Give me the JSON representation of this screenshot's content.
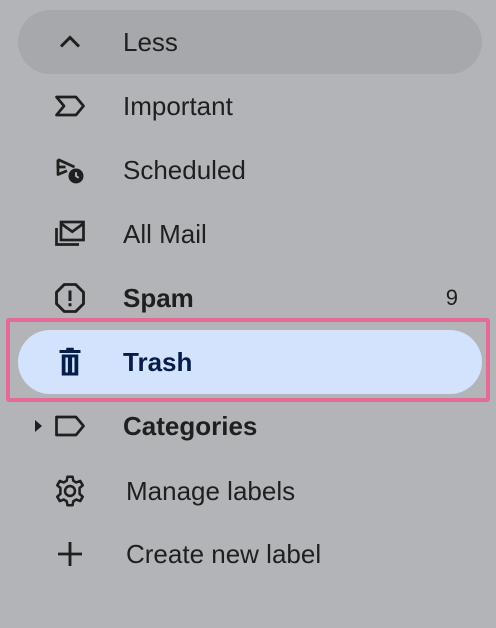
{
  "colors": {
    "background": "#b3b4b8",
    "hover_row": "#a7a8ac",
    "selected_row": "#d3e3fd",
    "selected_text": "#041e49",
    "highlight_border": "#e36b96"
  },
  "nav": {
    "items": [
      {
        "label": "Less",
        "icon": "chevron-up-icon"
      },
      {
        "label": "Important",
        "icon": "important-label-icon"
      },
      {
        "label": "Scheduled",
        "icon": "scheduled-send-icon"
      },
      {
        "label": "All Mail",
        "icon": "all-mail-icon"
      },
      {
        "label": "Spam",
        "icon": "spam-icon",
        "count": "9"
      },
      {
        "label": "Trash",
        "icon": "trash-icon",
        "selected": true
      },
      {
        "label": "Categories",
        "icon": "label-icon"
      },
      {
        "label": "Manage labels",
        "icon": "gear-icon"
      },
      {
        "label": "Create new label",
        "icon": "plus-icon"
      }
    ]
  }
}
